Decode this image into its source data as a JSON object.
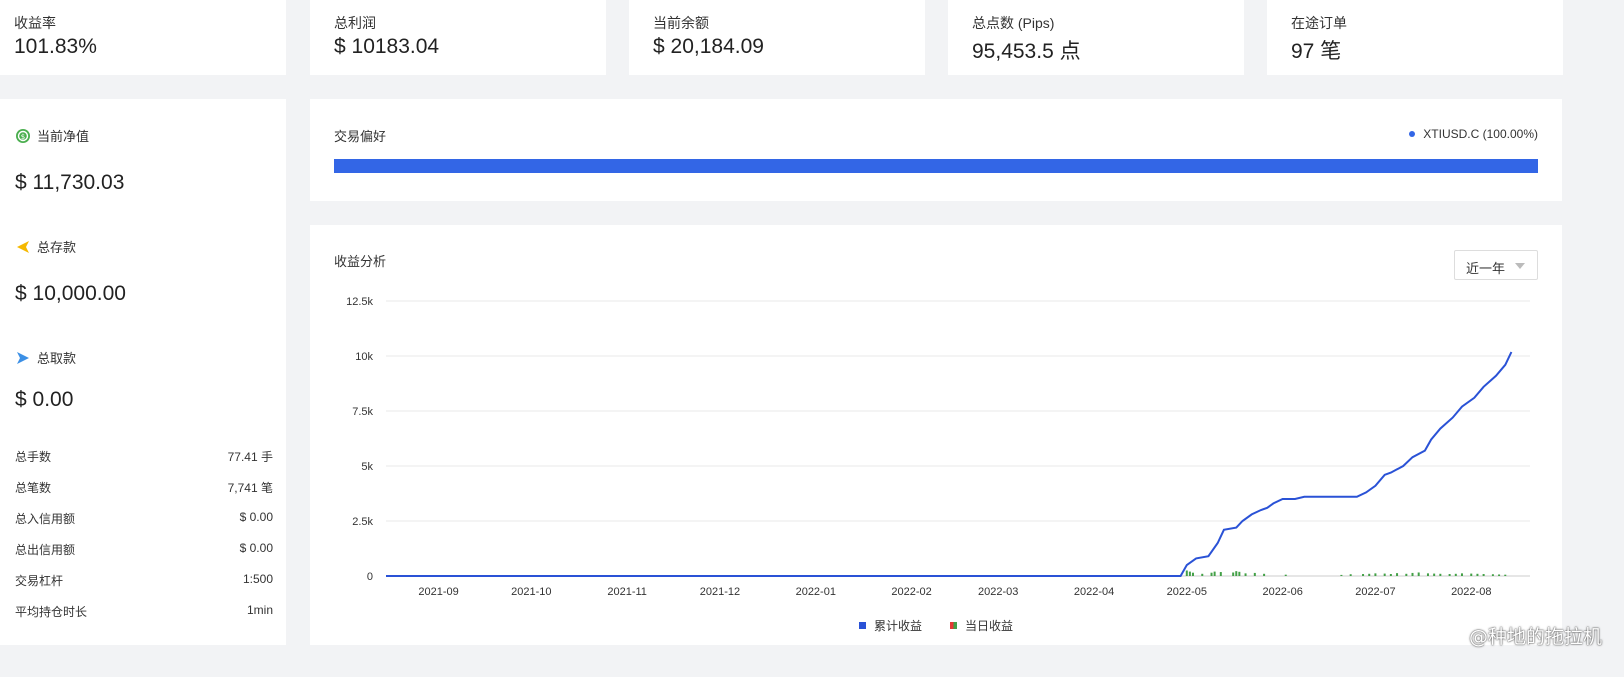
{
  "stats": [
    {
      "label": "收益率",
      "value": "101.83%"
    },
    {
      "label": "总利润",
      "value": "$ 10183.04"
    },
    {
      "label": "当前余额",
      "value": "$ 20,184.09"
    },
    {
      "label": "总点数 (Pips)",
      "value": "95,453.5 点"
    },
    {
      "label": "在途订单",
      "value": "97 笔"
    }
  ],
  "sidebar": {
    "equity": {
      "label": "当前净值",
      "value": "$ 11,730.03",
      "icon": "equity-icon"
    },
    "deposit": {
      "label": "总存款",
      "value": "$ 10,000.00",
      "icon": "deposit-icon"
    },
    "withdraw": {
      "label": "总取款",
      "value": "$ 0.00",
      "icon": "withdraw-icon"
    },
    "details": [
      {
        "label": "总手数",
        "value": "77.41 手"
      },
      {
        "label": "总笔数",
        "value": "7,741 笔"
      },
      {
        "label": "总入信用额",
        "value": "$ 0.00"
      },
      {
        "label": "总出信用额",
        "value": "$ 0.00"
      },
      {
        "label": "交易杠杆",
        "value": "1:500"
      },
      {
        "label": "平均持仓时长",
        "value": "1min"
      }
    ]
  },
  "preference": {
    "title": "交易偏好",
    "legend": "XTIUSD.C (100.00%)",
    "share": 1.0,
    "color": "#3366e6"
  },
  "analysis": {
    "title": "收益分析",
    "range_selected": "近一年",
    "legend_cumulative": "累计收益",
    "legend_daily": "当日收益"
  },
  "chart_data": {
    "type": "line",
    "x": [
      "2021-08-15",
      "2022-04-29",
      "2022-05-01",
      "2022-05-04",
      "2022-05-08",
      "2022-05-11",
      "2022-05-13",
      "2022-05-17",
      "2022-05-19",
      "2022-05-22",
      "2022-05-25",
      "2022-05-27",
      "2022-05-29",
      "2022-06-01",
      "2022-06-05",
      "2022-06-08",
      "2022-06-25",
      "2022-06-28",
      "2022-07-01",
      "2022-07-04",
      "2022-07-06",
      "2022-07-10",
      "2022-07-13",
      "2022-07-17",
      "2022-07-19",
      "2022-07-22",
      "2022-07-26",
      "2022-07-29",
      "2022-08-02",
      "2022-08-05",
      "2022-08-09",
      "2022-08-12",
      "2022-08-14"
    ],
    "series": [
      {
        "name": "累计收益",
        "color": "#2a52d6",
        "values": [
          0,
          0,
          500,
          800,
          900,
          1500,
          2100,
          2200,
          2500,
          2800,
          3000,
          3100,
          3300,
          3500,
          3500,
          3600,
          3600,
          3800,
          4100,
          4600,
          4700,
          5000,
          5400,
          5700,
          6200,
          6700,
          7200,
          7700,
          8100,
          8600,
          9100,
          9600,
          10183
        ]
      },
      {
        "name": "当日收益",
        "type": "bar",
        "colors": [
          "#e53935",
          "#43a047"
        ],
        "x": [
          "2022-05-01",
          "2022-05-02",
          "2022-05-03",
          "2022-05-06",
          "2022-05-09",
          "2022-05-10",
          "2022-05-12",
          "2022-05-16",
          "2022-05-17",
          "2022-05-18",
          "2022-05-20",
          "2022-05-23",
          "2022-05-26",
          "2022-06-02",
          "2022-06-20",
          "2022-06-23",
          "2022-06-27",
          "2022-06-29",
          "2022-07-01",
          "2022-07-04",
          "2022-07-06",
          "2022-07-08",
          "2022-07-11",
          "2022-07-13",
          "2022-07-15",
          "2022-07-18",
          "2022-07-20",
          "2022-07-22",
          "2022-07-25",
          "2022-07-27",
          "2022-07-29",
          "2022-08-01",
          "2022-08-03",
          "2022-08-05",
          "2022-08-08",
          "2022-08-10",
          "2022-08-12"
        ],
        "values": [
          250,
          200,
          150,
          100,
          150,
          200,
          180,
          160,
          220,
          190,
          120,
          140,
          100,
          60,
          50,
          80,
          90,
          100,
          120,
          110,
          90,
          130,
          100,
          140,
          160,
          120,
          110,
          100,
          90,
          100,
          120,
          110,
          100,
          90,
          80,
          70,
          60
        ]
      }
    ],
    "ylim": [
      0,
      12500
    ],
    "yticks": [
      "0",
      "2.5k",
      "5k",
      "7.5k",
      "10k",
      "12.5k"
    ],
    "ytick_values": [
      0,
      2500,
      5000,
      7500,
      10000,
      12500
    ],
    "xticks": [
      "2021-09",
      "2021-10",
      "2021-11",
      "2021-12",
      "2022-01",
      "2022-02",
      "2022-03",
      "2022-04",
      "2022-05",
      "2022-06",
      "2022-07",
      "2022-08"
    ],
    "xtick_dates": [
      "2021-09-01",
      "2021-10-01",
      "2021-11-01",
      "2021-12-01",
      "2022-01-01",
      "2022-02-01",
      "2022-03-01",
      "2022-04-01",
      "2022-05-01",
      "2022-06-01",
      "2022-07-01",
      "2022-08-01"
    ],
    "xlim": [
      "2021-08-15",
      "2022-08-20"
    ],
    "grid": true,
    "legend_position": "bottom"
  },
  "watermark": "@种地的拖拉机"
}
